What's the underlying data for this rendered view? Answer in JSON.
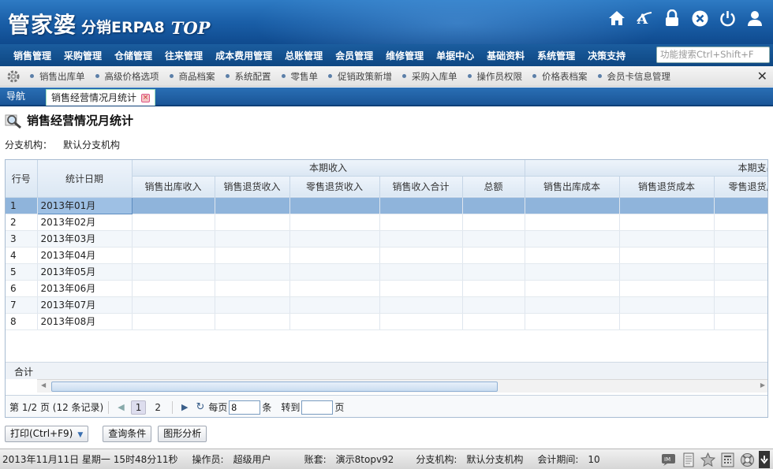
{
  "logo": {
    "brand": "管家婆",
    "product": "分销ERPA8",
    "edition": "TOP"
  },
  "header_icons": [
    "home-icon",
    "font-icon",
    "lock-icon",
    "close-circle-icon",
    "power-icon",
    "user-icon"
  ],
  "menu": [
    "销售管理",
    "采购管理",
    "仓储管理",
    "往来管理",
    "成本费用管理",
    "总账管理",
    "会员管理",
    "维修管理",
    "单据中心",
    "基础资料",
    "系统管理",
    "决策支持"
  ],
  "search": {
    "placeholder": "功能搜索Ctrl+Shift+F"
  },
  "quicklinks": [
    "销售出库单",
    "高级价格选项",
    "商品档案",
    "系统配置",
    "零售单",
    "促销政策新增",
    "采购入库单",
    "操作员权限",
    "价格表档案",
    "会员卡信息管理"
  ],
  "tabs": {
    "nav": "导航",
    "active": "销售经营情况月统计"
  },
  "page": {
    "title": "销售经营情况月统计",
    "branch_label": "分支机构：",
    "branch_value": "默认分支机构"
  },
  "table": {
    "col_rownum": "行号",
    "col_date": "统计日期",
    "group_income": "本期收入",
    "group_expense": "本期支出",
    "income_cols": [
      "销售出库收入",
      "销售退货收入",
      "零售退货收入",
      "销售收入合计",
      "总额"
    ],
    "expense_cols": [
      "销售出库成本",
      "销售退货成本",
      "零售退货成本"
    ],
    "rows": [
      {
        "n": "1",
        "date": "2013年01月"
      },
      {
        "n": "2",
        "date": "2013年02月"
      },
      {
        "n": "3",
        "date": "2013年03月"
      },
      {
        "n": "4",
        "date": "2013年04月"
      },
      {
        "n": "5",
        "date": "2013年05月"
      },
      {
        "n": "6",
        "date": "2013年06月"
      },
      {
        "n": "7",
        "date": "2013年07月"
      },
      {
        "n": "8",
        "date": "2013年08月"
      }
    ],
    "selected_row": 1,
    "sum_label": "合计"
  },
  "pager": {
    "info": "第 1/2 页 (12 条记录)",
    "page1": "1",
    "page2": "2",
    "per_page_label": "每页",
    "per_page": "8",
    "unit": "条",
    "goto_label": "转到",
    "goto_value": "",
    "page_unit": "页"
  },
  "buttons": {
    "print": "打印(Ctrl+F9)",
    "query": "查询条件",
    "chart": "图形分析"
  },
  "status": {
    "datetime": "2013年11月11日 星期一 15时48分11秒",
    "operator_label": "操作员:",
    "operator": "超级用户",
    "account_label": "账套:",
    "account": "演示8topv92",
    "branch_label": "分支机构:",
    "branch": "默认分支机构",
    "period_label": "会计期间:",
    "period": "10"
  },
  "colors": {
    "header": "#1a5fa8",
    "menu": "#0e4783",
    "selected_row": "#8fb4db"
  }
}
